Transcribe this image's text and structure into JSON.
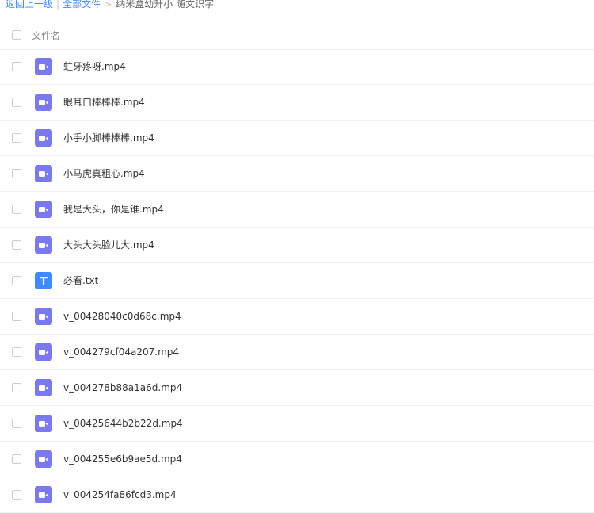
{
  "breadcrumb": {
    "back_label": "返回上一级",
    "separator": "|",
    "all_files_label": "全部文件",
    "arrow": ">",
    "current_folder": "纳米盒幼升小 随文识字"
  },
  "header": {
    "column_label": "文件名"
  },
  "colors": {
    "video_icon": "#7b79f2",
    "text_icon": "#3b8cff",
    "link": "#3b8cff"
  },
  "files": [
    {
      "name": "蛀牙疼呀.mp4",
      "icon": "video-icon"
    },
    {
      "name": "眼耳口棒棒棒.mp4",
      "icon": "video-icon"
    },
    {
      "name": "小手小脚棒棒棒.mp4",
      "icon": "video-icon"
    },
    {
      "name": "小马虎真粗心.mp4",
      "icon": "video-icon"
    },
    {
      "name": "我是大头，你是谁.mp4",
      "icon": "video-icon"
    },
    {
      "name": "大头大头脸儿大.mp4",
      "icon": "video-icon"
    },
    {
      "name": "必看.txt",
      "icon": "text-file-icon"
    },
    {
      "name": "v_00428040c0d68c.mp4",
      "icon": "video-icon"
    },
    {
      "name": "v_004279cf04a207.mp4",
      "icon": "video-icon"
    },
    {
      "name": "v_004278b88a1a6d.mp4",
      "icon": "video-icon"
    },
    {
      "name": "v_00425644b2b22d.mp4",
      "icon": "video-icon"
    },
    {
      "name": "v_004255e6b9ae5d.mp4",
      "icon": "video-icon"
    },
    {
      "name": "v_004254fa86fcd3.mp4",
      "icon": "video-icon"
    }
  ]
}
